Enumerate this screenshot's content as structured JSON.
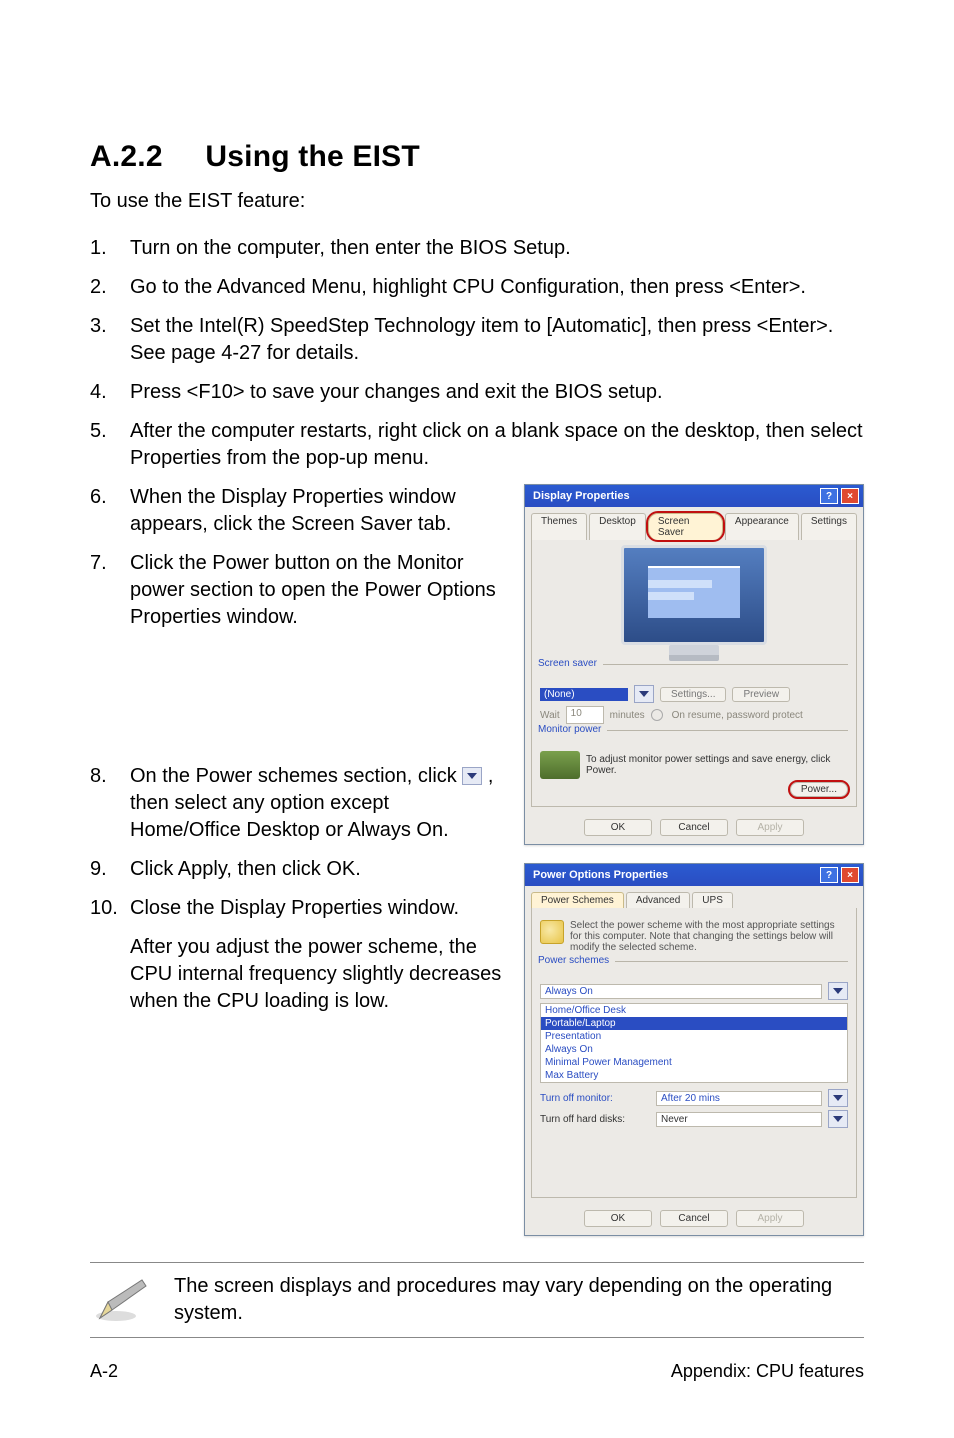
{
  "heading": {
    "number": "A.2.2",
    "title": "Using the EIST"
  },
  "intro": "To use the EIST feature:",
  "steps": [
    "Turn on the computer, then enter the BIOS Setup.",
    "Go to the Advanced Menu, highlight CPU Configuration, then press <Enter>.",
    "Set the Intel(R) SpeedStep Technology item to [Automatic], then press <Enter>. See page 4-27 for details.",
    "Press <F10> to save your changes and exit the BIOS setup.",
    "After the computer restarts, right click on a blank space on the desktop, then select Properties from the pop-up menu.",
    "When the Display Properties window appears, click the Screen Saver tab.",
    "Click the Power button on the Monitor power section to open the Power Options Properties window.",
    "On the Power schemes section, click  , then select any option except Home/Office Desktop or Always On.",
    "Click Apply, then click OK.",
    "Close the Display Properties window."
  ],
  "afterNote": "After you adjust the power scheme, the CPU internal frequency slightly decreases when the CPU loading is low.",
  "pencilNote": "The screen displays and procedures may vary depending on the operating system.",
  "footer": {
    "left": "A-2",
    "right": "Appendix: CPU features"
  },
  "dlg1": {
    "title": "Display Properties",
    "tabs": [
      "Themes",
      "Desktop",
      "Screen Saver",
      "Appearance",
      "Settings"
    ],
    "group1": "Screen saver",
    "screensaver_selected": "(None)",
    "btn_settings": "Settings...",
    "btn_preview": "Preview",
    "wait_label": "Wait",
    "wait_minutes": "minutes",
    "resume_label": "On resume, password protect",
    "group2": "Monitor power",
    "monitor_desc": "To adjust monitor power settings and save energy, click Power.",
    "power_btn": "Power...",
    "ok": "OK",
    "cancel": "Cancel",
    "apply": "Apply"
  },
  "dlg2": {
    "title": "Power Options Properties",
    "tabs": [
      "Power Schemes",
      "Advanced",
      "UPS"
    ],
    "desc": "Select the power scheme with the most appropriate settings for this computer. Note that changing the settings below will modify the selected scheme.",
    "group1": "Power schemes",
    "selected": "Always On",
    "options": [
      "Home/Office Desk",
      "Portable/Laptop",
      "Presentation",
      "Always On",
      "Minimal Power Management",
      "Max Battery"
    ],
    "monitor_lbl": "Turn off monitor:",
    "monitor_val": "After 20 mins",
    "disk_lbl": "Turn off hard disks:",
    "disk_val": "Never",
    "ok": "OK",
    "cancel": "Cancel",
    "apply": "Apply"
  }
}
